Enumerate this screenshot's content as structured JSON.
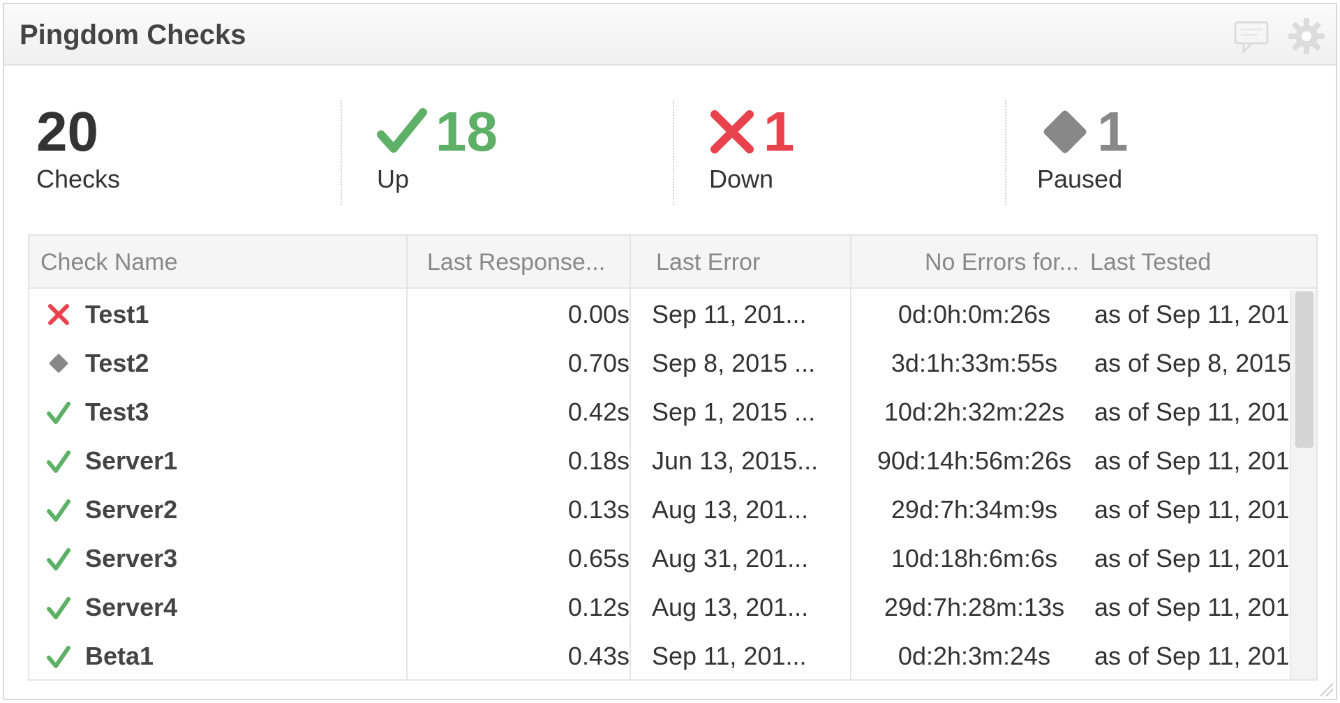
{
  "widget": {
    "title": "Pingdom Checks",
    "header_icons": [
      "comment-icon",
      "gear-icon"
    ]
  },
  "summary": {
    "total": {
      "value": "20",
      "label": "Checks"
    },
    "up": {
      "value": "18",
      "label": "Up",
      "color": "#5db065"
    },
    "down": {
      "value": "1",
      "label": "Down",
      "color": "#e8424d"
    },
    "paused": {
      "value": "1",
      "label": "Paused",
      "color": "#888888"
    }
  },
  "table": {
    "columns": [
      "Check Name",
      "Last Response...",
      "Last Error",
      "No Errors for...",
      "Last Tested"
    ],
    "rows": [
      {
        "status": "down",
        "name": "Test1",
        "response": "0.00s",
        "last_error": "Sep 11, 201...",
        "no_errors": "0d:0h:0m:26s",
        "last_tested": "as of Sep 11, 201"
      },
      {
        "status": "paused",
        "name": "Test2",
        "response": "0.70s",
        "last_error": "Sep 8, 2015 ...",
        "no_errors": "3d:1h:33m:55s",
        "last_tested": "as of Sep 8, 2015"
      },
      {
        "status": "up",
        "name": "Test3",
        "response": "0.42s",
        "last_error": "Sep 1, 2015 ...",
        "no_errors": "10d:2h:32m:22s",
        "last_tested": "as of Sep 11, 201"
      },
      {
        "status": "up",
        "name": "Server1",
        "response": "0.18s",
        "last_error": "Jun 13, 2015...",
        "no_errors": "90d:14h:56m:26s",
        "last_tested": "as of Sep 11, 201"
      },
      {
        "status": "up",
        "name": "Server2",
        "response": "0.13s",
        "last_error": "Aug 13, 201...",
        "no_errors": "29d:7h:34m:9s",
        "last_tested": "as of Sep 11, 201"
      },
      {
        "status": "up",
        "name": "Server3",
        "response": "0.65s",
        "last_error": "Aug 31, 201...",
        "no_errors": "10d:18h:6m:6s",
        "last_tested": "as of Sep 11, 201"
      },
      {
        "status": "up",
        "name": "Server4",
        "response": "0.12s",
        "last_error": "Aug 13, 201...",
        "no_errors": "29d:7h:28m:13s",
        "last_tested": "as of Sep 11, 201"
      },
      {
        "status": "up",
        "name": "Beta1",
        "response": "0.43s",
        "last_error": "Sep 11, 201...",
        "no_errors": "0d:2h:3m:24s",
        "last_tested": "as of Sep 11, 201"
      }
    ]
  },
  "colors": {
    "up": "#5db065",
    "down": "#e8424d",
    "paused": "#888888"
  }
}
